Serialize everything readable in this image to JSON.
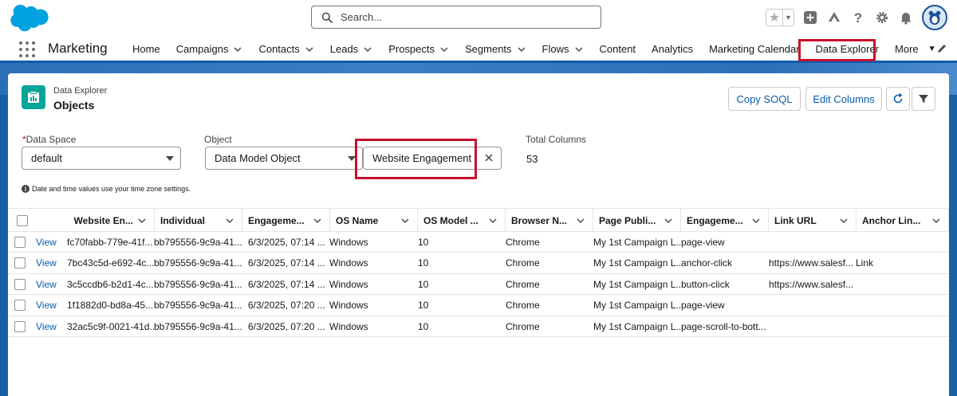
{
  "search": {
    "placeholder": "Search..."
  },
  "app": {
    "name": "Marketing"
  },
  "nav": {
    "items": [
      {
        "label": "Home",
        "has_menu": false
      },
      {
        "label": "Campaigns",
        "has_menu": true
      },
      {
        "label": "Contacts",
        "has_menu": true
      },
      {
        "label": "Leads",
        "has_menu": true
      },
      {
        "label": "Prospects",
        "has_menu": true
      },
      {
        "label": "Segments",
        "has_menu": true
      },
      {
        "label": "Flows",
        "has_menu": true
      },
      {
        "label": "Content",
        "has_menu": false
      },
      {
        "label": "Analytics",
        "has_menu": false
      },
      {
        "label": "Marketing Calendar",
        "has_menu": false
      },
      {
        "label": "Data Explorer",
        "has_menu": false,
        "active": true
      },
      {
        "label": "More",
        "has_menu": true
      }
    ]
  },
  "page": {
    "subtitle": "Data Explorer",
    "title": "Objects",
    "buttons": {
      "copy_soql": "Copy SOQL",
      "edit_columns": "Edit Columns"
    }
  },
  "filters": {
    "data_space": {
      "label": "Data Space",
      "required_mark": "*",
      "value": "default"
    },
    "object": {
      "label": "Object",
      "value": "Data Model Object"
    },
    "object_name": {
      "value": "Website Engagement"
    },
    "total_columns": {
      "label": "Total Columns",
      "value": "53"
    },
    "timezone_note": "Date and time values use your time zone settings."
  },
  "table": {
    "columns": [
      "Website En...",
      "Individual",
      "Engageme...",
      "OS Name",
      "OS Model ...",
      "Browser N...",
      "Page Publi...",
      "Engageme...",
      "Link URL",
      "Anchor Lin..."
    ],
    "view_label": "View",
    "rows": [
      [
        "fc70fabb-779e-41f...",
        "bb795556-9c9a-41...",
        "6/3/2025, 07:14 ...",
        "Windows",
        "10",
        "Chrome",
        "My 1st Campaign L...",
        "page-view",
        "",
        ""
      ],
      [
        "7bc43c5d-e692-4c...",
        "bb795556-9c9a-41...",
        "6/3/2025, 07:14 ...",
        "Windows",
        "10",
        "Chrome",
        "My 1st Campaign L...",
        "anchor-click",
        "https://www.salesf...",
        "Link"
      ],
      [
        "3c5ccdb6-b2d1-4c...",
        "bb795556-9c9a-41...",
        "6/3/2025, 07:14 ...",
        "Windows",
        "10",
        "Chrome",
        "My 1st Campaign L...",
        "button-click",
        "https://www.salesf...",
        ""
      ],
      [
        "1f1882d0-bd8a-45...",
        "bb795556-9c9a-41...",
        "6/3/2025, 07:20 ...",
        "Windows",
        "10",
        "Chrome",
        "My 1st Campaign L...",
        "page-view",
        "",
        ""
      ],
      [
        "32ac5c9f-0021-41d...",
        "bb795556-9c9a-41...",
        "6/3/2025, 07:20 ...",
        "Windows",
        "10",
        "Chrome",
        "My 1st Campaign L...",
        "page-scroll-to-bott...",
        "",
        ""
      ]
    ]
  },
  "colors": {
    "brand_blue": "#0b5cab",
    "highlight_red": "#c8102e",
    "object_icon_teal": "#06a59a",
    "backdrop_blue": "#1b5fa8"
  },
  "icons": {
    "logo": "salesforce-cloud-logo",
    "search": "search-icon",
    "favorites": "star-icon",
    "add": "plus-icon",
    "trailhead": "trailhead-icon",
    "help": "question-icon",
    "settings": "gear-icon",
    "notifications": "bell-icon",
    "avatar": "user-avatar",
    "refresh": "refresh-icon",
    "filter": "filter-icon",
    "clear": "close-icon",
    "info": "info-icon",
    "edit_nav": "pencil-icon"
  }
}
